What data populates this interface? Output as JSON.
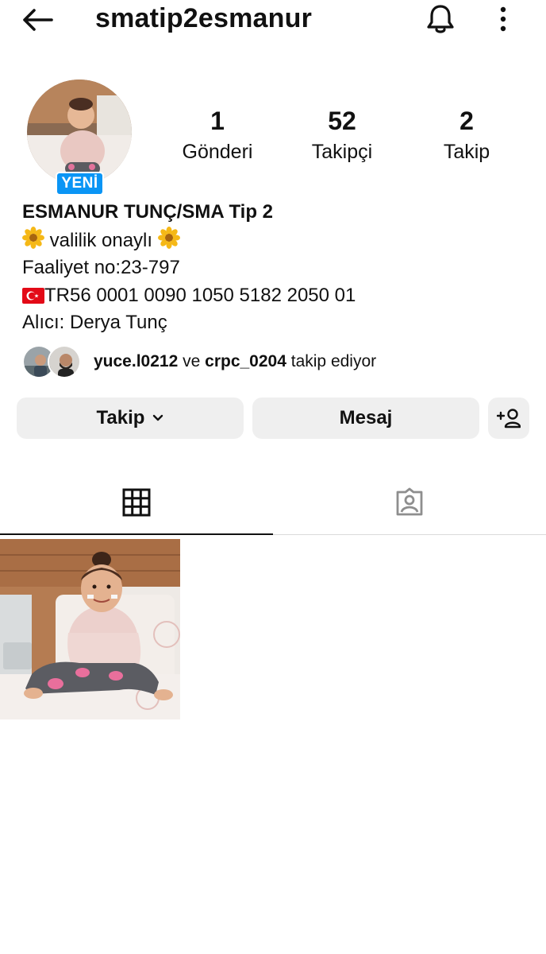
{
  "header": {
    "username": "smatip2esmanur",
    "back_icon": "arrow-left-icon",
    "bell_icon": "bell-icon",
    "more_icon": "more-vertical-icon"
  },
  "profile": {
    "new_badge": "YENİ",
    "stats": {
      "posts": {
        "value": "1",
        "label": "Gönderi"
      },
      "followers": {
        "value": "52",
        "label": "Takipçi"
      },
      "following": {
        "value": "2",
        "label": "Takip"
      }
    },
    "bio": {
      "name": "ESMANUR TUNÇ/SMA Tip 2",
      "line2": "valilik onaylı",
      "line3": "Faaliyet no:23-797",
      "line4": "TR56 0001 0090 1050 5182 2050 01",
      "line5": "Alıcı: Derya Tunç"
    },
    "followed_by": {
      "user1": "yuce.l0212",
      "conjunction": "ve",
      "user2": "crpc_0204",
      "suffix": "takip ediyor"
    }
  },
  "actions": {
    "follow_label": "Takip",
    "message_label": "Mesaj",
    "add_user_icon": "add-user-icon"
  },
  "tabs": {
    "grid_icon": "grid-icon",
    "tagged_icon": "tagged-icon",
    "active": "grid"
  },
  "colors": {
    "badge_blue": "#0a95f5",
    "button_bg": "#efefef",
    "divider": "#dbdbdb",
    "text": "#111111"
  }
}
